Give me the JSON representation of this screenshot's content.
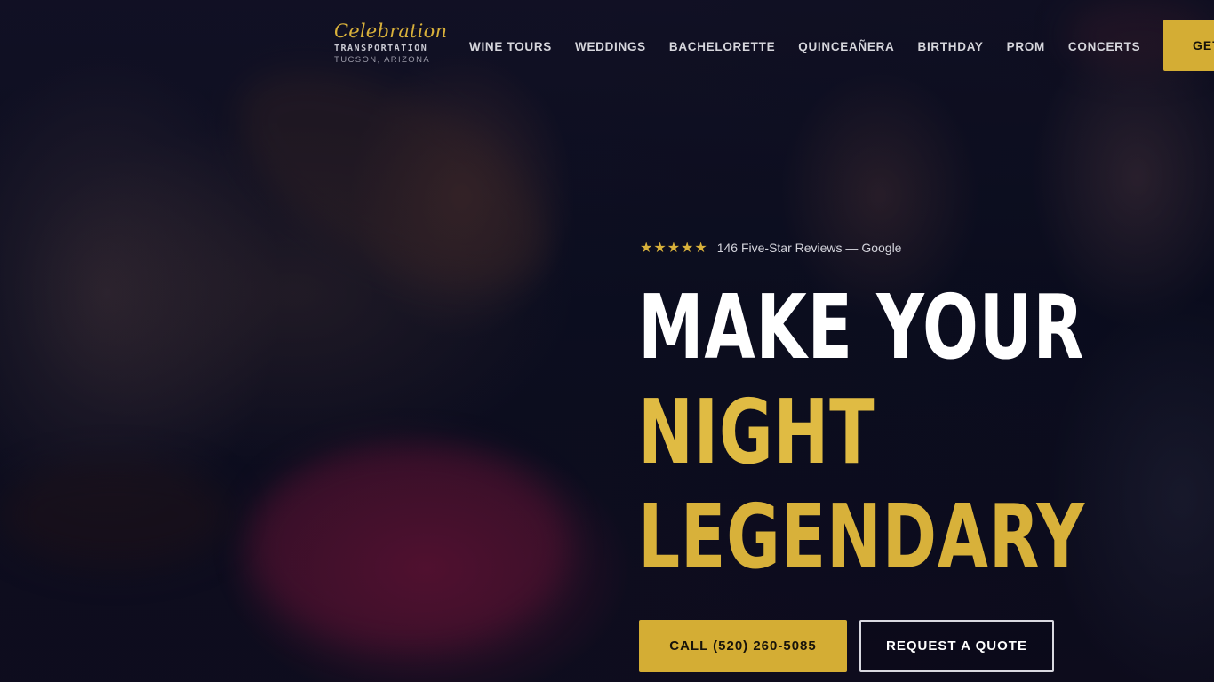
{
  "brand": {
    "script": "Celebration",
    "sub": "TRANSPORTATION",
    "location": "TUCSON, ARIZONA"
  },
  "nav": {
    "items": [
      "WINE TOURS",
      "WEDDINGS",
      "BACHELORETTE",
      "QUINCEAÑERA",
      "BIRTHDAY",
      "PROM",
      "CONCERTS"
    ],
    "cta_label": "GET"
  },
  "hero": {
    "stars": "★★★★★",
    "rating_text": "146 Five-Star Reviews — Google",
    "headline_line1": "MAKE YOUR",
    "headline_line2": "NIGHT",
    "headline_line3": "LEGENDARY",
    "call_button": "CALL (520) 260-5085",
    "quote_button": "REQUEST A QUOTE"
  },
  "colors": {
    "accent_gold": "#d4ad34",
    "headline_white": "#ffffff",
    "background": "#0b0d1c"
  }
}
